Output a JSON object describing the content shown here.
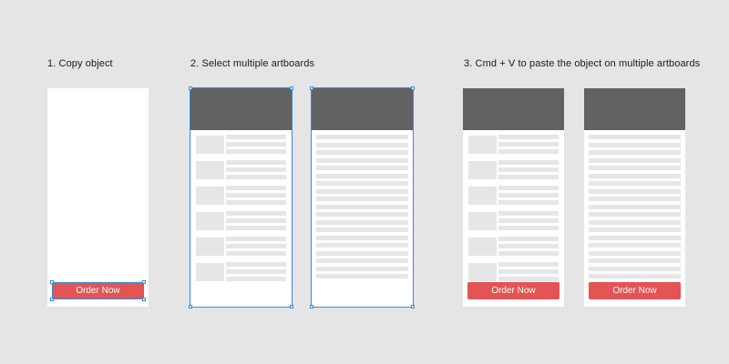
{
  "steps": [
    {
      "label": "1. Copy object"
    },
    {
      "label": "2. Select multiple artboards"
    },
    {
      "label": "3. Cmd + V to paste the object on multiple artboards"
    }
  ],
  "button": {
    "label": "Order Now",
    "color": "#e35454"
  },
  "colors": {
    "background": "#e5e5e5",
    "header": "#626262",
    "placeholder": "#e6e6e6",
    "selection": "#2f8de4"
  }
}
